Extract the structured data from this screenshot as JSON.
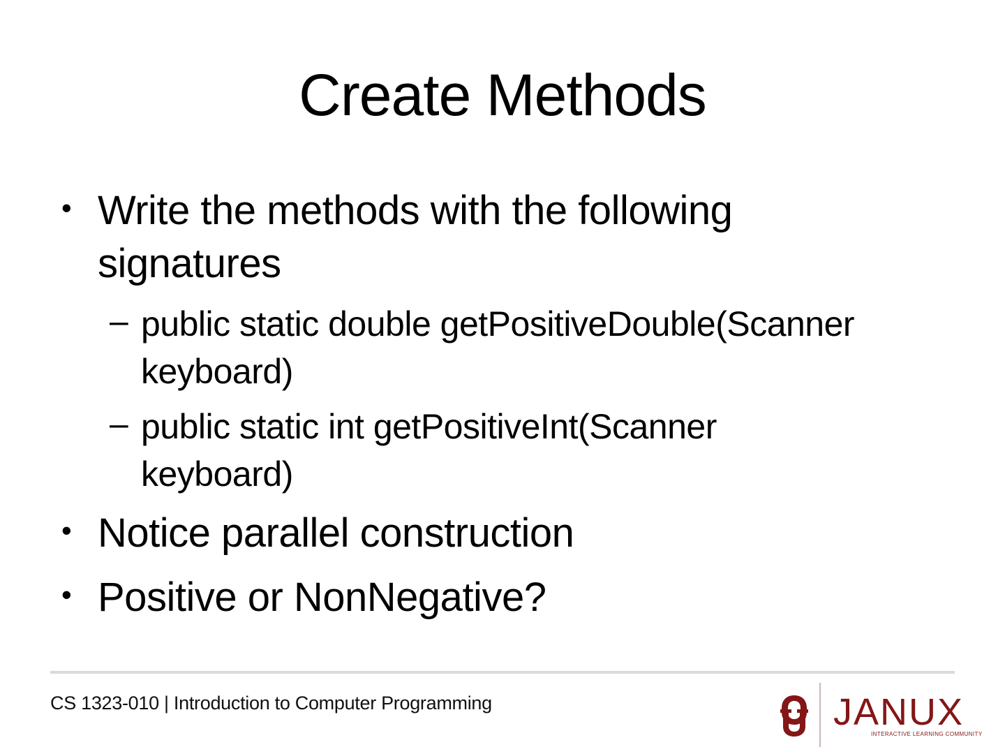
{
  "slide": {
    "title": "Create Methods",
    "bullets": [
      {
        "text_lines": [
          "Write the methods with the following",
          "signatures"
        ],
        "sub_items": [
          {
            "text_lines": [
              "public static double getPositiveDouble(Scanner",
              "keyboard)"
            ]
          },
          {
            "text_lines": [
              "public static int getPositiveInt(Scanner",
              "keyboard)"
            ]
          }
        ]
      },
      {
        "text_lines": [
          "Notice parallel construction"
        ]
      },
      {
        "text_lines": [
          "Positive or NonNegative?"
        ]
      }
    ],
    "bullet_glyph": "•",
    "sub_bullet_glyph": "–"
  },
  "footer": {
    "course": "CS 1323-010 | Introduction to Computer Programming",
    "logo": {
      "icon": "ou-interlocking-logo-icon",
      "wordmark": "JANUX",
      "tagline": "INTERACTIVE LEARNING COMMUNITY",
      "brand_color": "#841617"
    }
  }
}
